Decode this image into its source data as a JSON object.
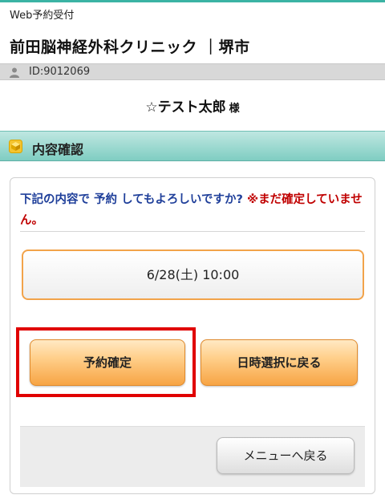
{
  "header": {
    "service_label": "Web予約受付",
    "clinic_name": "前田脳神経外科クリニック ｜堺市"
  },
  "user": {
    "id_text": "ID:9012069",
    "icon": "person-icon",
    "patient_name": "☆テスト太郎",
    "honorific": "様"
  },
  "section": {
    "title": "内容確認",
    "icon": "cube-icon"
  },
  "confirm": {
    "message": "下記の内容で 予約 してもよろしいですか?",
    "warning": "※まだ確定していません。",
    "datetime": "6/28(土) 10:00"
  },
  "buttons": {
    "confirm_label": "予約確定",
    "back_to_date_label": "日時選択に戻る",
    "menu_label": "メニューへ戻る"
  },
  "colors": {
    "accent_teal": "#7fcdc2",
    "button_orange": "#f7a444",
    "highlight_red": "#e00000",
    "warning_red": "#c00000",
    "message_blue": "#1f3f9a"
  }
}
